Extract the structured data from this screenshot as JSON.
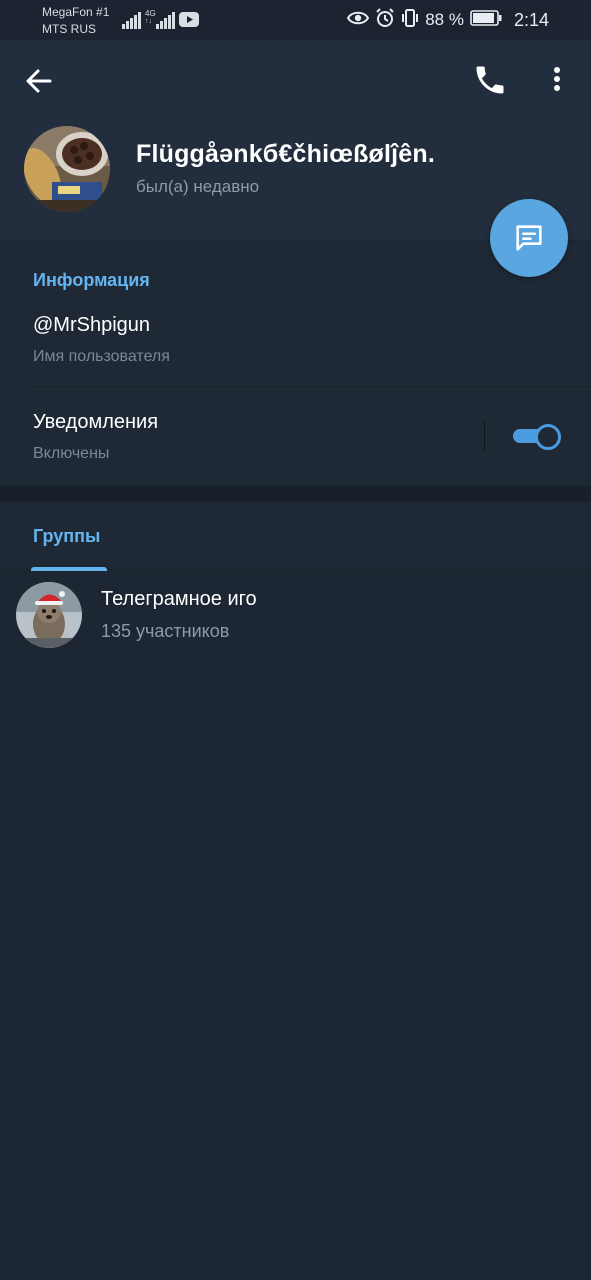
{
  "status_bar": {
    "carrier_1": "MegaFon #1",
    "carrier_2": "MTS RUS",
    "network": "4G",
    "battery": "88 %",
    "time": "2:14"
  },
  "header": {
    "name": "Flüggåənkб€čhiœßølĵên.",
    "last_seen": "был(а) недавно",
    "icons": [
      "back-arrow-icon",
      "phone-icon",
      "more-vertical-icon",
      "message-icon"
    ]
  },
  "info": {
    "section_title": "Информация",
    "username": "@MrShpigun",
    "username_label": "Имя пользователя",
    "notifications_title": "Уведомления",
    "notifications_status": "Включены",
    "notifications_enabled": true
  },
  "tabs": [
    {
      "label": "Группы",
      "active": true
    }
  ],
  "groups": [
    {
      "name": "Телеграмное иго",
      "members": "135 участников"
    }
  ],
  "colors": {
    "accent": "#64b5ef",
    "fab": "#5aa6e0",
    "background": "#1d2633",
    "header": "#222e3d",
    "secondary_text": "#8d9aaa"
  }
}
